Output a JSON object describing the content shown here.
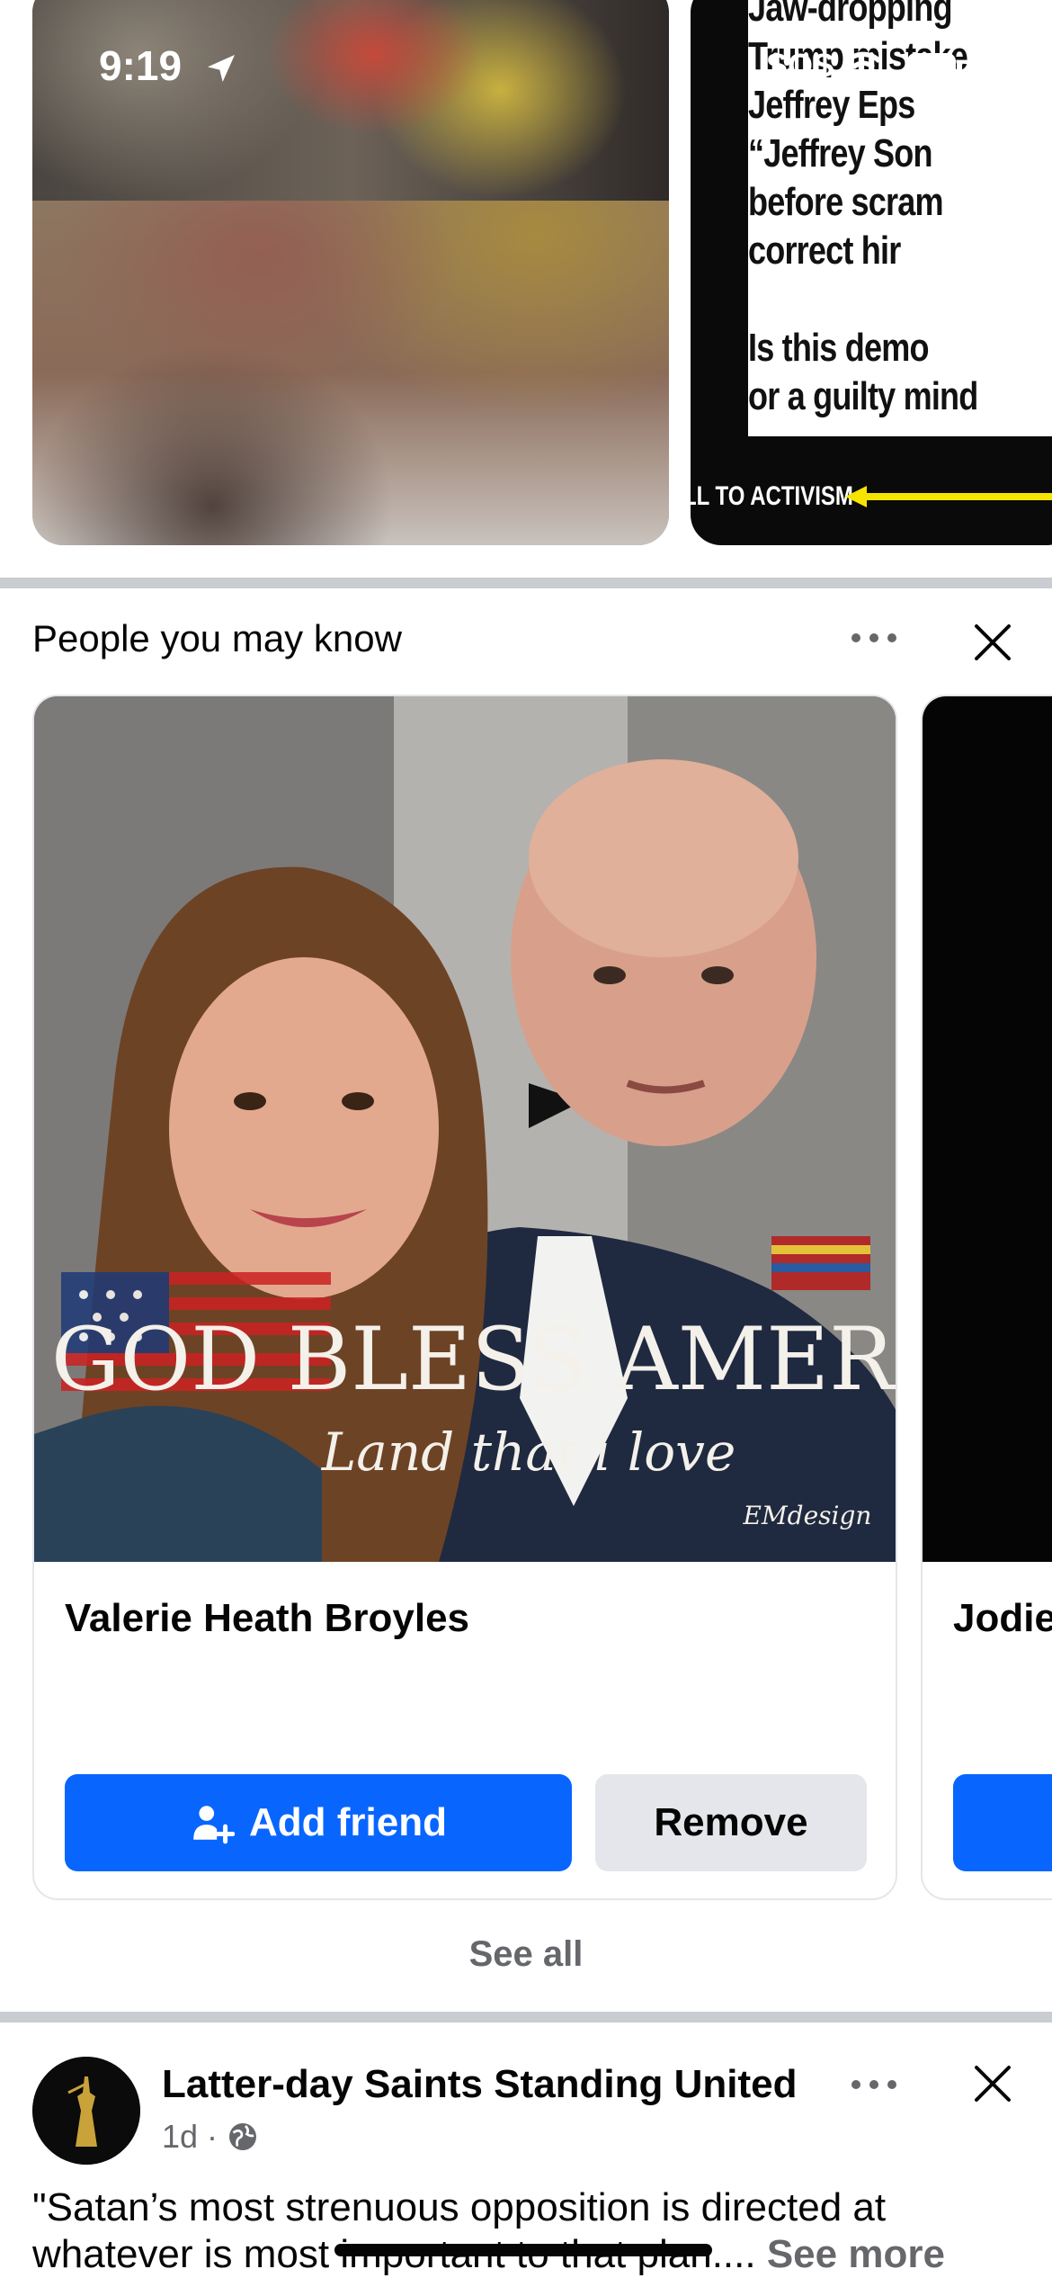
{
  "status_bar": {
    "time": "9:19",
    "carrier": "SOS",
    "icons": [
      "location-arrow-icon",
      "wifi-icon",
      "battery-icon"
    ]
  },
  "reels": {
    "right_reel_lines": [
      "Jaw-dropping",
      "Trump mistake",
      "Jeffrey Eps",
      "“Jeffrey Son",
      "before scram",
      "correct hir",
      "",
      "Is this demo",
      "or a guilty mind"
    ],
    "right_reel_footer": "LL TO ACTIVISM"
  },
  "pymk": {
    "title": "People you may know",
    "cards": [
      {
        "name": "Valerie Heath Broyles",
        "photo_caption": "GOD BLESS AMERICA",
        "photo_script": "Land that i love",
        "photo_signature": "EMdesign",
        "add_label": "Add friend",
        "remove_label": "Remove"
      },
      {
        "name": "Jodie"
      }
    ],
    "see_all": "See all"
  },
  "post": {
    "author": "Latter-day Saints Standing United",
    "time": "1d",
    "separator": "·",
    "text": "\"Satan’s most strenuous opposition is directed at whatever is most important to that plan....",
    "see_more": "See more"
  },
  "colors": {
    "primary": "#0866ff",
    "secondary_button": "#e4e6eb",
    "muted_text": "#65676b",
    "divider": "#c9ccd1"
  }
}
